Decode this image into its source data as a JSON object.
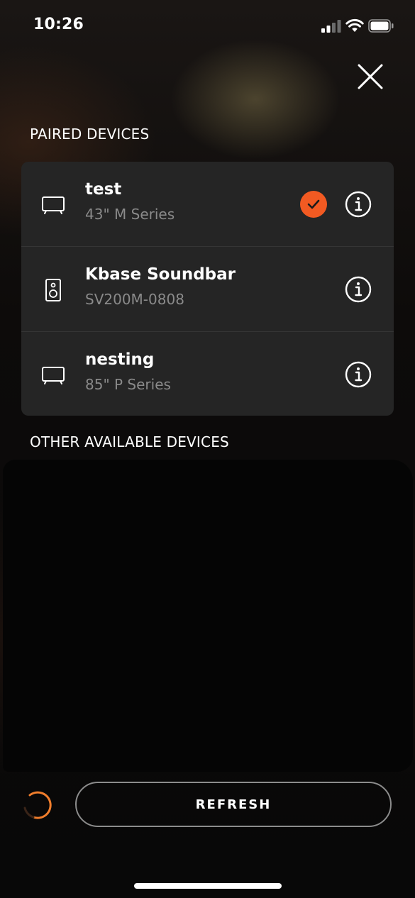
{
  "status_bar": {
    "time": "10:26",
    "icons": [
      "signal-icon",
      "wifi-icon",
      "battery-icon"
    ]
  },
  "paired_section": {
    "title": "PAIRED DEVICES",
    "devices": [
      {
        "name": "test",
        "model": "43\" M Series",
        "icon": "tv-icon",
        "selected": true
      },
      {
        "name": "Kbase Soundbar",
        "model": "SV200M-0808",
        "icon": "speaker-icon",
        "selected": false
      },
      {
        "name": "nesting",
        "model": "85\" P Series",
        "icon": "tv-icon",
        "selected": false
      }
    ]
  },
  "other_section": {
    "title": "OTHER AVAILABLE DEVICES"
  },
  "footer": {
    "refresh_label": "REFRESH"
  },
  "colors": {
    "accent": "#f25a22",
    "card_bg": "#252525",
    "subtext": "#8a8a8a"
  }
}
